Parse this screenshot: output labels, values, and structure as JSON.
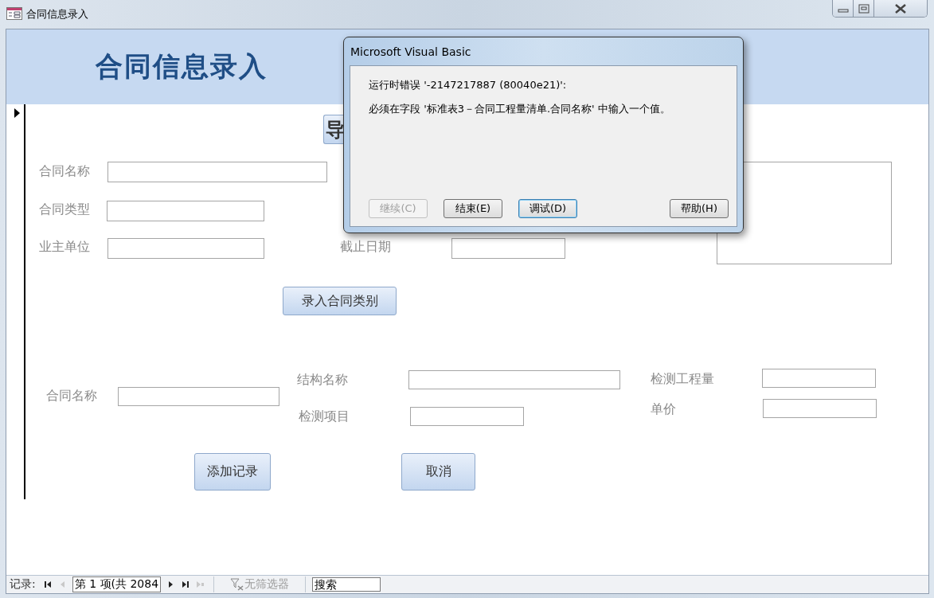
{
  "window": {
    "title": "合同信息录入"
  },
  "header": {
    "title": "合同信息录入"
  },
  "top_fields": [
    {
      "label": "合同名称"
    },
    {
      "label": "合同类型"
    },
    {
      "label": "业主单位"
    },
    {
      "label": "截止日期"
    }
  ],
  "covered_button": {
    "label": "导"
  },
  "category_button": {
    "label": "录入合同类别"
  },
  "bottom_fields": [
    {
      "label": "合同名称"
    },
    {
      "label": "结构名称"
    },
    {
      "label": "检测项目"
    },
    {
      "label": "检测工程量"
    },
    {
      "label": "单价"
    }
  ],
  "action_buttons": [
    {
      "label": "添加记录"
    },
    {
      "label": "取消"
    }
  ],
  "navigation": {
    "label": "记录:",
    "record": "第 1 项(共 2084",
    "filter": {
      "label": "无筛选器",
      "disabled": true
    },
    "search": {
      "placeholder": "搜索"
    }
  },
  "dialog": {
    "title": "Microsoft Visual Basic",
    "messages": [
      "运行时错误 '-2147217887 (80040e21)':",
      "必须在字段 '标准表3－合同工程量清单.合同名称' 中输入一个值。"
    ],
    "buttons": [
      {
        "label": "继续(C)",
        "disabled": true,
        "focused": false
      },
      {
        "label": "结束(E)",
        "disabled": false,
        "focused": false
      },
      {
        "label": "调试(D)",
        "disabled": false,
        "focused": true
      },
      {
        "label": "帮助(H)",
        "disabled": false,
        "focused": false
      }
    ]
  }
}
